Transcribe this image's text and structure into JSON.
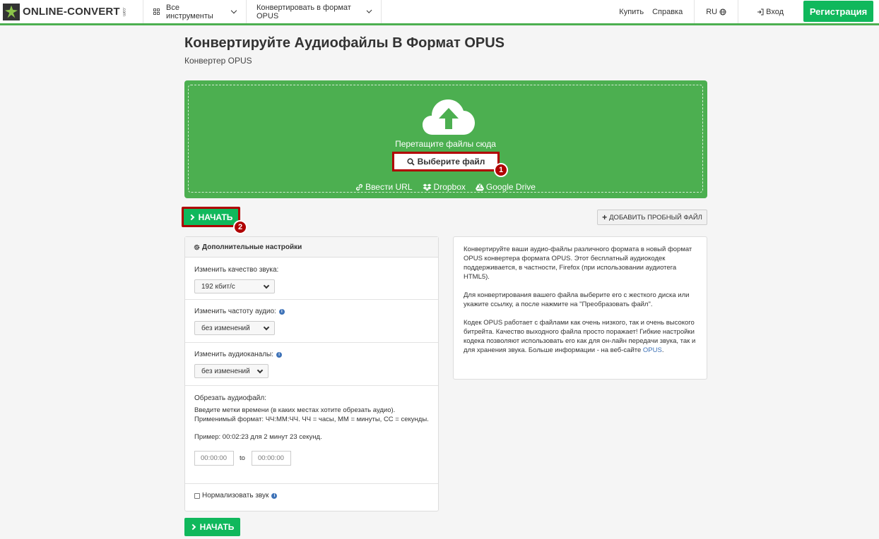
{
  "header": {
    "logo_main": "ONLINE-CONVERT",
    "logo_com": ".com",
    "all_tools": "Все инструменты",
    "convert_to": "Конвертировать в формат OPUS",
    "buy": "Купить",
    "help": "Справка",
    "lang": "RU",
    "login": "Вход",
    "register": "Регистрация"
  },
  "page": {
    "title": "Конвертируйте Аудиофайлы В Формат OPUS",
    "subtitle": "Конвертер OPUS"
  },
  "dropzone": {
    "drop_text": "Перетащите файлы сюда",
    "choose_file": "Выберите файл",
    "badge1": "1",
    "enter_url": "Ввести URL",
    "dropbox": "Dropbox",
    "google_drive": "Google Drive"
  },
  "actions": {
    "start": "НАЧАТЬ",
    "badge2": "2",
    "add_sample": "ДОБАВИТЬ ПРОБНЫЙ ФАЙЛ"
  },
  "settings": {
    "header": "Дополнительные настройки",
    "quality_label": "Изменить качество звука:",
    "quality_value": "192 кбит/с",
    "frequency_label": "Изменить частоту аудио:",
    "frequency_value": "без изменений",
    "channels_label": "Изменить аудиоканалы:",
    "channels_value": "без изменений",
    "trim_label": "Обрезать аудиофайл:",
    "trim_help": "Введите метки времени (в каких местах хотите обрезать аудио). Применимый формат: ЧЧ:ММ:ЧЧ. ЧЧ = часы, ММ = минуты, СС = секунды.",
    "trim_example": "Пример: 00:02:23 для 2 минут 23 секунд.",
    "trim_from_placeholder": "00:00:00",
    "trim_to_label": "to",
    "trim_to_placeholder": "00:00:00",
    "normalize_label": "Нормализовать звук"
  },
  "info": {
    "p1": "Конвертируйте ваши аудио-файлы различного формата в новый формат OPUS конвертера формата OPUS. Этот бесплатный аудиокодек поддерживается, в частности, Firefox (при использовании аудиотега HTML5).",
    "p2": "Для конвертирования вашего файла выберите его с жесткого диска или укажите ссылку, а после нажмите на \"Преобразовать файл\".",
    "p3_text": "Кодек OPUS работает с файлами как очень низкого, так и очень высокого битрейта. Качество выходного файла просто поражает! Гибкие настройки кодека позволяют использовать его как для он-лайн передачи звука, так и для хранения звука. Больше информации - на веб-сайте",
    "p3_link": "OPUS",
    "p3_end": "."
  },
  "colors": {
    "brand_green": "#4caf50",
    "button_green": "#10b85c",
    "highlight_red": "#b00000",
    "link_blue": "#3f73b8"
  }
}
